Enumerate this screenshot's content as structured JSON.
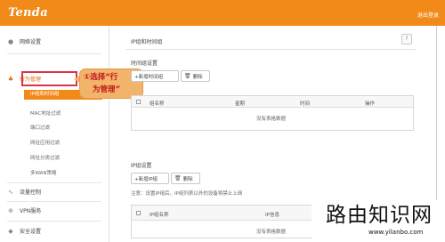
{
  "header": {
    "brand": "Tenda",
    "logout": "退出登录"
  },
  "sidebar": {
    "network_settings": "网络设置",
    "behavior_mgmt": "行为管理",
    "sub_items": [
      "IP组和时间组",
      "MAC地址过滤",
      "端口过滤",
      "网址应用过滤",
      "网址分类过滤",
      "多WAN策略"
    ],
    "traffic_control": "流量控制",
    "vpn_service": "VPN服务",
    "security_settings": "安全设置"
  },
  "callout": {
    "line1": "①选择“行",
    "line2": "为管理”"
  },
  "panel": {
    "title": "IP组和时间组",
    "help": "?",
    "time_group": {
      "label": "时间组设置",
      "add": "+新增时间组",
      "delete": "删除",
      "columns": [
        "组名称",
        "星期",
        "时间",
        "操作"
      ],
      "empty": "没有表格数据"
    },
    "ip_group": {
      "label": "IP组设置",
      "add": "+新增IP组",
      "delete": "删除",
      "note": "注意：设置IP组后，IP组列表以外的设备将禁止上网",
      "columns": [
        "IP组名称",
        "IP信息"
      ],
      "empty": "没有表格数据"
    }
  },
  "watermark": {
    "text": "路由知识网",
    "url": "www.yilanbo.com"
  }
}
